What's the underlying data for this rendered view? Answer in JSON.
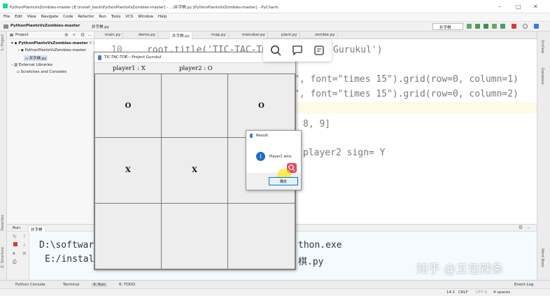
{
  "window": {
    "title": "PythonPlantsVsZombies-master [E:\\install_back\\PythonPlantsVsZombies-master] - ...\\井字棋.py [PythonPlantsVsZombies-master] - PyCharm",
    "controls": [
      "–",
      "□",
      "✕"
    ]
  },
  "menu": [
    "File",
    "Edit",
    "View",
    "Navigate",
    "Code",
    "Refactor",
    "Run",
    "Tools",
    "VCS",
    "Window",
    "Help"
  ],
  "nav": {
    "project": "PythonPlantsVsZombies-master",
    "file": "井字棋.py",
    "run_config": "井字棋"
  },
  "project_panel": {
    "title": "Project",
    "tree": [
      "PythonPlantsVsZombies-master",
      "PythonPlantsVsZombies-master",
      "井字棋.py",
      "External Libraries",
      "Scratches and Consoles"
    ],
    "root_suffix": "E:\\"
  },
  "tabs": [
    "main.py",
    "demo.py",
    "井字棋.py",
    "map.py",
    "menubar.py",
    "plant.py",
    "zombie.py"
  ],
  "editor": {
    "line_no": "10",
    "lines": [
      "root.title('TIC-TAC-TOE---Project Gurukul')",
      "\", font=\"times 15\").grid(row=0, column=1)",
      "\", font=\"times 15\").grid(row=0, column=2)",
      "8, 9]",
      "player2 sign= Y"
    ]
  },
  "run_panel": {
    "label": "Run:",
    "config": "井字棋",
    "output": [
      "D:\\software",
      "E:/install",
      "thon.exe",
      "棋.py"
    ]
  },
  "tk_window": {
    "title": "TIC-TAC-TOE---Project Gurukul",
    "player1": "player1 : X",
    "player2": "player2 : O",
    "cells": [
      "",
      "",
      "",
      "O",
      "",
      "O",
      "X",
      "X",
      "",
      "",
      "",
      ""
    ]
  },
  "message_box": {
    "title": "Result",
    "text": "Player1 wins",
    "ok_label": "确定"
  },
  "tool_windows": [
    "Python Console",
    "Terminal",
    "4: Run",
    "6: TODO"
  ],
  "event_log": "Event Log",
  "status": {
    "position": "14:1",
    "line_sep": "CRLF",
    "encoding": "UTF-8",
    "indent": "4 spaces"
  },
  "side_labels": {
    "left_top": "1: Project",
    "left_mid": "Favorites",
    "left_bottom": "Z: Structure",
    "right_top": "SciView",
    "right_mid": "Database",
    "right_bottom": "Word Book"
  },
  "watermark": "知乎 @五包辣条",
  "colors": {
    "accent": "#0078d7",
    "run_bg": "#f3fbff",
    "info_icon": "#1c6fc4",
    "search_btn": "#e84a5f"
  }
}
